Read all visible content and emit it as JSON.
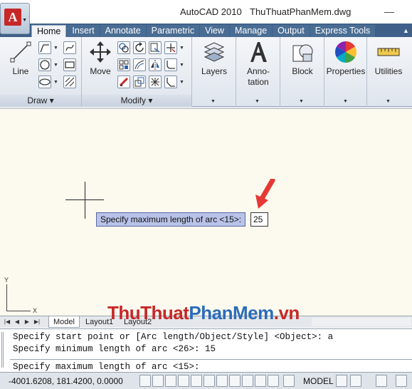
{
  "window": {
    "app_name": "AutoCAD 2010",
    "file_name": "ThuThuatPhanMem.dwg",
    "minimize_glyph": "—",
    "app_button_letter": "A"
  },
  "tabs": [
    "Home",
    "Insert",
    "Annotate",
    "Parametric",
    "View",
    "Manage",
    "Output",
    "Express Tools"
  ],
  "ribbon": {
    "panels": {
      "draw": "Draw",
      "modify": "Modify"
    },
    "tools": {
      "line": "Line",
      "move": "Move",
      "layers": "Layers",
      "annotation_line1": "Anno-",
      "annotation_line2": "tation",
      "block": "Block",
      "properties": "Properties",
      "utilities": "Utilities"
    },
    "icons": [
      "polyline-icon",
      "circle-icon",
      "arc-icon",
      "rectangle-icon",
      "hatch-icon",
      "rotate-icon",
      "copy-icon",
      "mirror-icon",
      "stretch-icon",
      "scale-icon",
      "array-icon",
      "erase-icon",
      "trim-icon",
      "fillet-icon"
    ]
  },
  "drawing": {
    "prompt_tooltip": "Specify maximum length of arc <15>:",
    "input_value": "25",
    "ucs_x": "X",
    "ucs_y": "Y",
    "accent_arrow_color": "#e53935"
  },
  "layout_tabs": [
    "Model",
    "Layout1",
    "Layout2"
  ],
  "watermark": {
    "part1": "ThuThuat",
    "part2": "PhanMem",
    "part3": ".vn"
  },
  "command": {
    "history": [
      "Specify start point or [Arc length/Object/Style] <Object>: a",
      "Specify minimum length of arc <26>: 15"
    ],
    "current_prompt": "Specify maximum length of arc <15>:"
  },
  "status": {
    "coordinates": "-4001.6208, 181.4200, 0.0000",
    "space": "MODEL"
  }
}
